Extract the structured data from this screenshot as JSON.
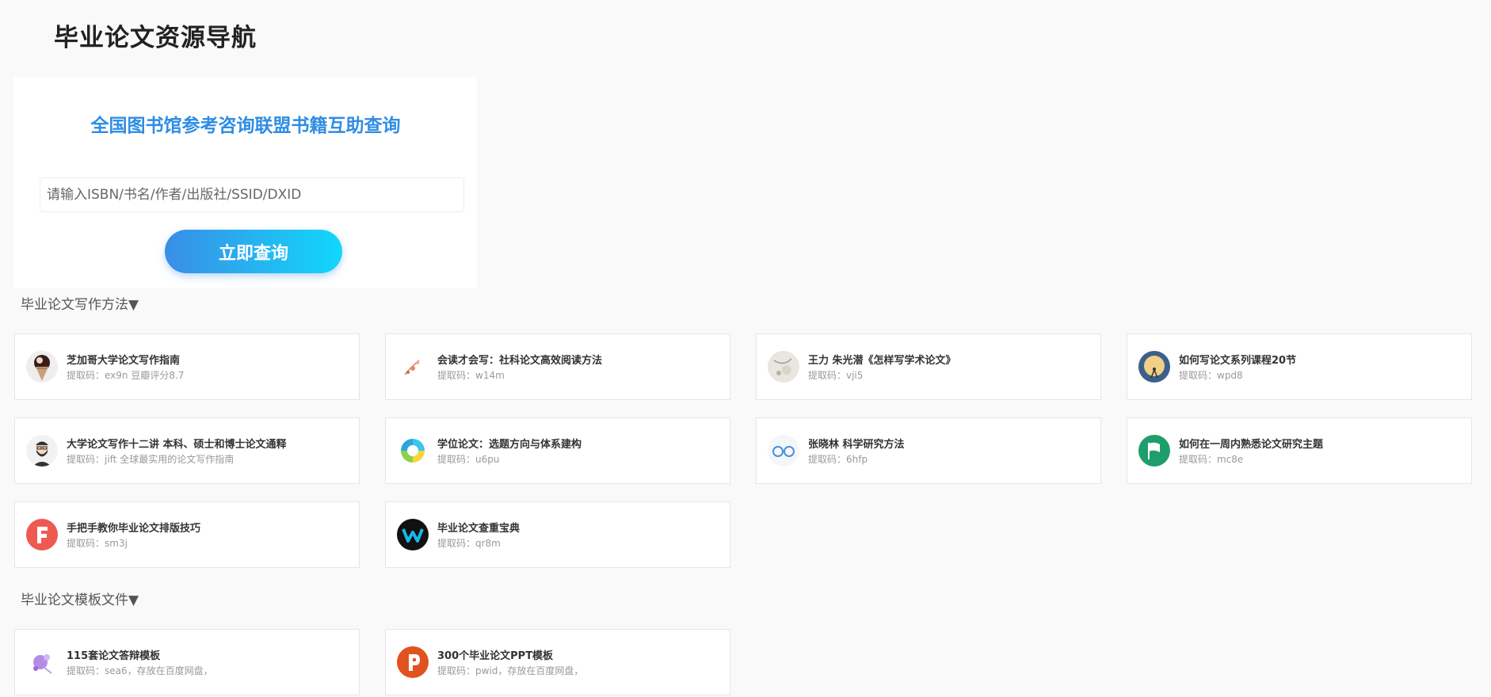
{
  "header": {
    "title": "毕业论文资源导航"
  },
  "search": {
    "title": "全国图书馆参考咨询联盟书籍互助查询",
    "placeholder": "请输入ISBN/书名/作者/出版社/SSID/DXID",
    "button_label": "立即查询"
  },
  "sections": [
    {
      "title": "毕业论文写作方法▼",
      "cards": [
        {
          "title": "芝加哥大学论文写作指南",
          "subtitle": "提取码：ex9n 豆瓣评分8.7",
          "icon": "ice-cream-avatar-icon"
        },
        {
          "title": "会读才会写：社科论文高效阅读方法",
          "subtitle": "提取码：w14m",
          "icon": "flower-sketch-avatar-icon"
        },
        {
          "title": "王力 朱光潜《怎样写学术论文》",
          "subtitle": "提取码：vji5",
          "icon": "ink-painting-avatar-icon"
        },
        {
          "title": "如何写论文系列课程20节",
          "subtitle": "提取码：wpd8",
          "icon": "moon-telescope-avatar-icon"
        },
        {
          "title": "大学论文写作十二讲 本科、硕士和博士论文通释",
          "subtitle": "提取码：jift 全球最实用的论文写作指南",
          "icon": "bearded-man-avatar-icon"
        },
        {
          "title": "学位论文：选题方向与体系建构",
          "subtitle": "提取码：u6pu",
          "icon": "color-ring-logo-icon"
        },
        {
          "title": "张晓林 科学研究方法",
          "subtitle": "提取码：6hfp",
          "icon": "glasses-icon"
        },
        {
          "title": "如何在一周内熟悉论文研究主题",
          "subtitle": "提取码：mc8e",
          "icon": "flag-icon"
        },
        {
          "title": "手把手教你毕业论文排版技巧",
          "subtitle": "提取码：sm3j",
          "icon": "letter-f-icon"
        },
        {
          "title": "毕业论文查重宝典",
          "subtitle": "提取码：qr8m",
          "icon": "letter-w-logo-icon"
        }
      ]
    },
    {
      "title": "毕业论文模板文件▼",
      "cards": [
        {
          "title": "115套论文答辩模板",
          "subtitle": "提取码：sea6，存放在百度网盘，",
          "icon": "purple-splash-avatar-icon"
        },
        {
          "title": "300个毕业论文PPT模板",
          "subtitle": "提取码：pwid，存放在百度网盘，",
          "icon": "powerpoint-icon"
        }
      ]
    }
  ],
  "colors": {
    "accent": "#2f8de4",
    "button_gradient_start": "#3a8ee6",
    "button_gradient_end": "#12d7fb",
    "background": "#f9f9f9"
  }
}
